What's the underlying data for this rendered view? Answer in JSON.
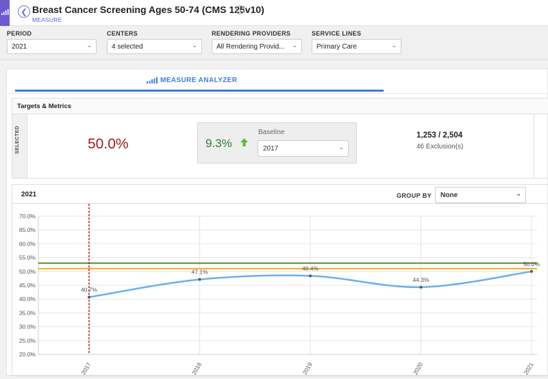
{
  "header": {
    "title": "Breast Cancer Screening Ages 50-74 (CMS 125v10)",
    "subtitle": "MEASURE"
  },
  "filters": [
    {
      "label": "PERIOD",
      "value": "2021"
    },
    {
      "label": "CENTERS",
      "value": "4 selected"
    },
    {
      "label": "RENDERING PROVIDERS",
      "value": "All Rendering Provid..."
    },
    {
      "label": "SERVICE LINES",
      "value": "Primary Care"
    }
  ],
  "tab": {
    "label": "MEASURE ANALYZER"
  },
  "targets": {
    "heading": "Targets & Metrics",
    "selected_strip": "SELECTED",
    "rate": "50.0%",
    "baseline_change": "9.3%",
    "baseline_label": "Baseline",
    "baseline_year": "2017",
    "ratio": "1,253 / 2,504",
    "exclusions": "46 Exclusion(s)"
  },
  "chart_panel": {
    "year": "2021",
    "group_by_label": "GROUP BY",
    "group_by_value": "None"
  },
  "colors": {
    "accent": "#3e7bdc",
    "rate": "#9e1b1b",
    "improvement": "#2f7d2f",
    "series": "#6aaef0",
    "target_green": "#5a8a2a",
    "target_orange": "#f5a623",
    "baseline_marker": "#b22222"
  },
  "chart_data": {
    "type": "line",
    "x": [
      "2017",
      "2018",
      "2019",
      "2020",
      "2021"
    ],
    "series": [
      {
        "values": [
          40.7,
          47.1,
          48.4,
          44.3,
          50.0
        ],
        "labels": [
          "40.7%",
          "47.1%",
          "48.4%",
          "44.3%",
          "50.0%"
        ]
      }
    ],
    "y_ticks": [
      "20.0%",
      "25.0%",
      "30.0%",
      "35.0%",
      "40.0%",
      "45.0%",
      "50.0%",
      "55.0%",
      "60.0%",
      "65.0%",
      "70.0%"
    ],
    "ylim": [
      20,
      70
    ],
    "reference_lines": [
      {
        "value": 53.0,
        "color": "#5a8a2a"
      },
      {
        "value": 51.0,
        "color": "#f5a623"
      }
    ],
    "baseline_x": "2017",
    "grid": true
  }
}
